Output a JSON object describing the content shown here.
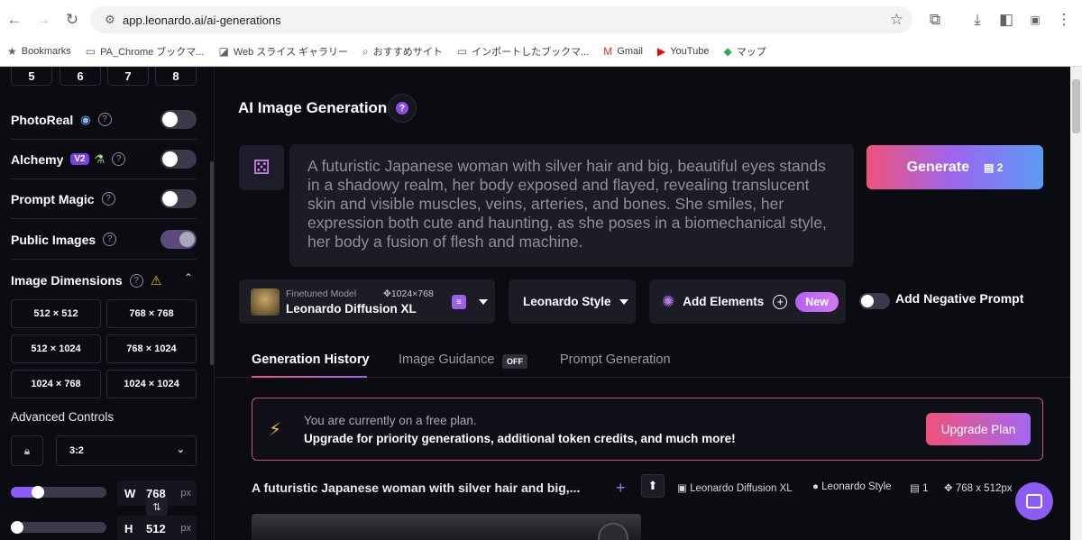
{
  "browser": {
    "url": "app.leonardo.ai/ai-generations",
    "bookmarks": [
      {
        "icon": "star-icon",
        "label": "Bookmarks"
      },
      {
        "icon": "folder-icon",
        "label": "PA_Chrome ブックマ..."
      },
      {
        "icon": "n-logo-icon",
        "label": "Web スライス ギャラリー"
      },
      {
        "icon": "search-icon",
        "label": "おすすめサイト"
      },
      {
        "icon": "folder-icon",
        "label": "インポートしたブックマ..."
      },
      {
        "icon": "gmail-icon",
        "label": "Gmail"
      },
      {
        "icon": "youtube-icon",
        "label": "YouTube"
      },
      {
        "icon": "maps-icon",
        "label": "マップ"
      }
    ]
  },
  "sidebar": {
    "numbers": [
      "5",
      "6",
      "7",
      "8"
    ],
    "toggles": [
      {
        "label": "PhotoReal",
        "on": false
      },
      {
        "label": "Alchemy",
        "badge": "V2",
        "on": false
      },
      {
        "label": "Prompt Magic",
        "on": false
      },
      {
        "label": "Public Images",
        "on": true
      }
    ],
    "dimensions_title": "Image Dimensions",
    "dimensions": [
      "512 × 512",
      "768 × 768",
      "512 × 1024",
      "768 × 1024",
      "1024 × 768",
      "1024 × 1024"
    ],
    "advanced": "Advanced Controls",
    "ratio": "3:2",
    "width": {
      "label": "W",
      "value": "768",
      "unit": "px"
    },
    "height": {
      "label": "H",
      "value": "512",
      "unit": "px"
    },
    "width_slider_fraction": 0.25,
    "height_slider_fraction": 0.0
  },
  "main": {
    "title": "AI Image Generation",
    "prompt": "A futuristic Japanese woman with silver hair and big, beautiful eyes stands in a shadowy realm, her body exposed and flayed, revealing translucent skin and visible muscles, veins, arteries, and bones. She smiles, her expression both cute and haunting, as she poses in a biomechanical style, her body a fusion of flesh and machine.",
    "generate": {
      "label": "Generate",
      "cost": "2"
    },
    "model": {
      "sub": "Finetuned Model",
      "res": "1024×768",
      "name": "Leonardo Diffusion XL"
    },
    "style": "Leonardo Style",
    "elements": {
      "label": "Add Elements",
      "new": "New"
    },
    "negative_prompt": "Add Negative Prompt",
    "tabs": [
      "Generation History",
      "Image Guidance",
      "Prompt Generation"
    ],
    "guidance_off": "OFF",
    "banner": {
      "line1": "You are currently on a free plan.",
      "line2": "Upgrade for priority generations, additional token credits, and much more!",
      "button": "Upgrade Plan"
    },
    "history": {
      "prompt": "A futuristic Japanese woman with silver hair and big,...",
      "model": "Leonardo Diffusion XL",
      "style": "Leonardo Style",
      "count": "1",
      "size": "768 x 512px"
    }
  },
  "colors": {
    "accent": "#8b5cf6",
    "pink": "#f0527a",
    "bg": "#0b0b12"
  }
}
